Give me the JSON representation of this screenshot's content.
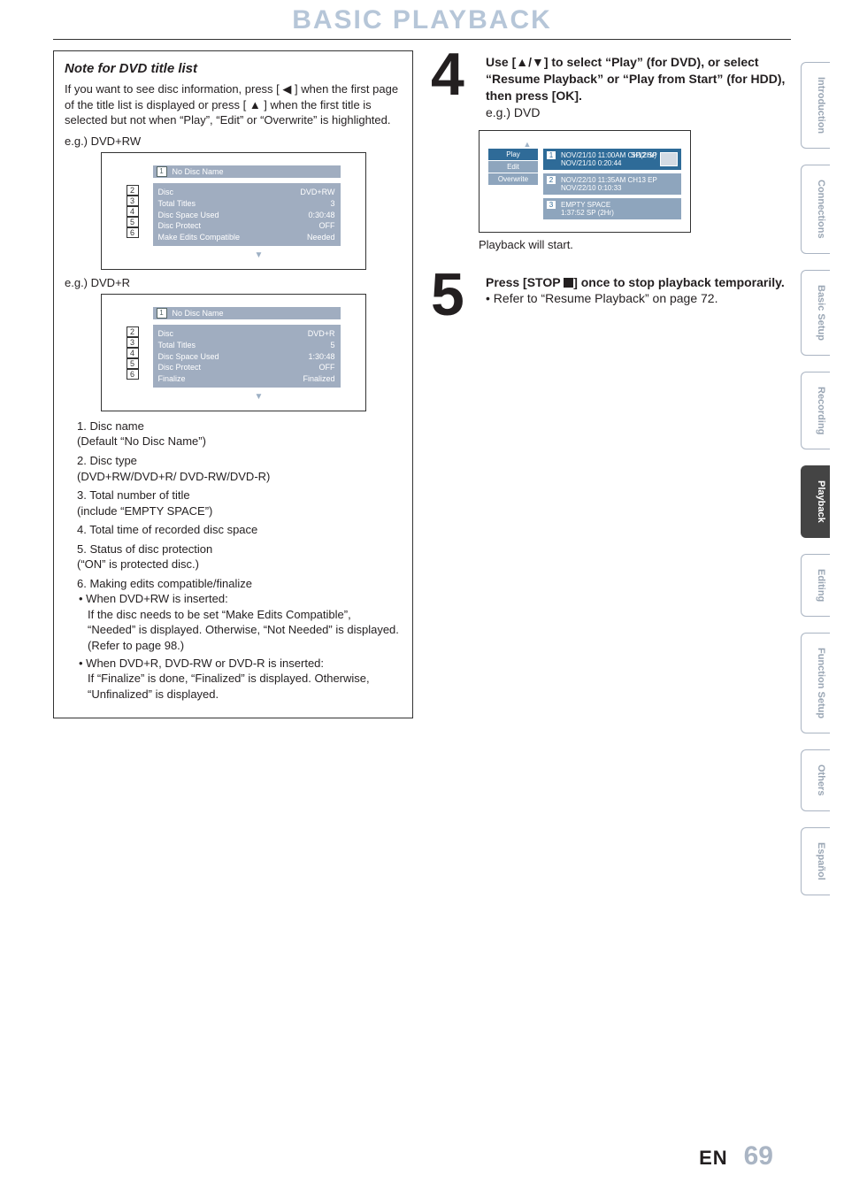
{
  "title": "BASIC PLAYBACK",
  "note": {
    "heading": "Note for DVD title list",
    "body": "If you want to see disc information, press [ ◀ ] when the first page of the title list is displayed or press [ ▲ ] when the first title is selected but not when “Play”, “Edit” or “Overwrite” is highlighted.",
    "eg1": "e.g.) DVD+RW",
    "eg2": "e.g.) DVD+R",
    "panel1": {
      "header_num": "1",
      "header_text": "No Disc Name",
      "rows": [
        {
          "k": "Disc",
          "v": "DVD+RW"
        },
        {
          "k": "Total Titles",
          "v": "3"
        },
        {
          "k": "Disc Space Used",
          "v": "0:30:48"
        },
        {
          "k": "Disc Protect",
          "v": "OFF"
        },
        {
          "k": "Make Edits Compatible",
          "v": "Needed"
        }
      ],
      "tags": [
        "2",
        "3",
        "4",
        "5",
        "6"
      ]
    },
    "panel2": {
      "header_num": "1",
      "header_text": "No Disc Name",
      "rows": [
        {
          "k": "Disc",
          "v": "DVD+R"
        },
        {
          "k": "Total Titles",
          "v": "5"
        },
        {
          "k": "Disc Space Used",
          "v": "1:30:48"
        },
        {
          "k": "Disc Protect",
          "v": "OFF"
        },
        {
          "k": "Finalize",
          "v": "Finalized"
        }
      ],
      "tags": [
        "2",
        "3",
        "4",
        "5",
        "6"
      ]
    },
    "items": {
      "n1": "1. Disc name",
      "n1s": "(Default “No Disc Name”)",
      "n2": "2. Disc type",
      "n2s": "(DVD+RW/DVD+R/ DVD-RW/DVD-R)",
      "n3": "3. Total number of title",
      "n3s": "(include “EMPTY SPACE”)",
      "n4": "4. Total time of recorded disc space",
      "n5": "5. Status of disc protection",
      "n5s": "(“ON” is protected disc.)",
      "n6": "6. Making edits compatible/finalize",
      "n6a": "When DVD+RW is inserted:",
      "n6a2": "If the disc needs to be set “Make Edits Compatible”, “Needed” is displayed. Otherwise, “Not Needed” is displayed. (Refer to page 98.)",
      "n6b": "When DVD+R, DVD-RW or DVD-R is inserted:",
      "n6b2": "If “Finalize” is done, “Finalized”  is displayed. Otherwise, “Unfinalized” is displayed."
    }
  },
  "step4": {
    "num": "4",
    "line1": "Use [▲/▼] to select “Play” (for DVD), or select “Resume Playback” or “Play from Start” (for HDD), then press [OK].",
    "eg": "e.g.) DVD",
    "menu": {
      "m1": "Play",
      "m2": "Edit",
      "m3": "Overwrite"
    },
    "sp": "SP(2Hr)",
    "e1_tag": "1",
    "e1_l1": "NOV/21/10  11:00AM CH12  SP",
    "e1_l2": "NOV/21/10   0:20:44",
    "e2_tag": "2",
    "e2_l1": "NOV/22/10  11:35AM CH13  EP",
    "e2_l2": "NOV/22/10   0:10:33",
    "e3_tag": "3",
    "e3_l1": "EMPTY SPACE",
    "e3_l2": "1:37:52  SP (2Hr)",
    "after": "Playback will start."
  },
  "step5": {
    "num": "5",
    "line1a": "Press [STOP ",
    "line1b": "] once to stop playback temporarily.",
    "bullet": "Refer to “Resume Playback” on page 72."
  },
  "tabs": {
    "t1": "Introduction",
    "t2": "Connections",
    "t3": "Basic Setup",
    "t4": "Recording",
    "t5": "Playback",
    "t6": "Editing",
    "t7": "Function Setup",
    "t8": "Others",
    "t9": "Español"
  },
  "footer": {
    "lang": "EN",
    "page": "69"
  }
}
